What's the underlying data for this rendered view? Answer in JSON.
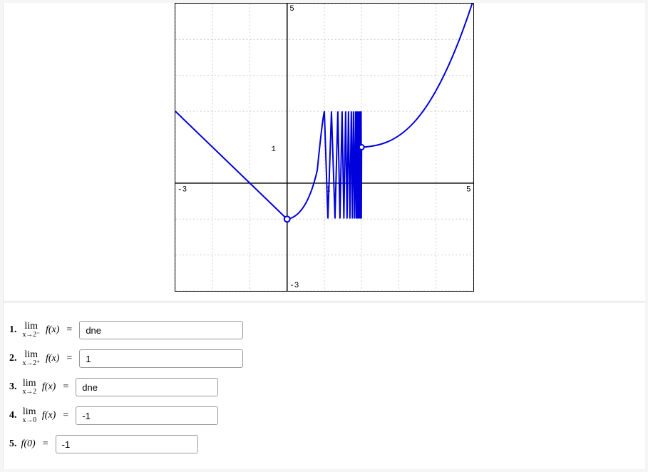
{
  "chart_data": {
    "type": "line",
    "title": "",
    "xlabel": "",
    "ylabel": "",
    "xlim": [
      -3,
      5
    ],
    "ylim": [
      -3,
      5
    ],
    "x_ticks": [
      -3,
      1.0,
      5
    ],
    "y_ticks": [
      -3,
      1.0,
      5
    ],
    "annotations": [
      "1.0",
      "1.0",
      "-3",
      "5",
      "-3",
      "5"
    ],
    "grid": true,
    "features": [
      {
        "desc": "linear decreasing segment",
        "from": [
          -3,
          2
        ],
        "to": [
          0,
          -1
        ]
      },
      {
        "desc": "open circle",
        "at": [
          0,
          -1
        ]
      },
      {
        "desc": "curve from (0,-1) up to local max",
        "to_approx": [
          1,
          2
        ]
      },
      {
        "desc": "dense oscillation (sin(1/(x-2)) style)",
        "interval_x": [
          1,
          2
        ],
        "amplitude_y": [
          -1,
          2
        ]
      },
      {
        "desc": "filled point at right side of oscillation",
        "at": [
          2,
          1
        ]
      },
      {
        "desc": "smooth increasing curve",
        "from": [
          2,
          1
        ],
        "to": [
          5,
          5
        ]
      }
    ]
  },
  "questions": [
    {
      "num": "1.",
      "lim_top": "lim",
      "lim_sub": "x→2⁻",
      "expr": "f(x)",
      "eq": "=",
      "value": "dne",
      "input_class": ""
    },
    {
      "num": "2.",
      "lim_top": "lim",
      "lim_sub": "x→2⁺",
      "expr": "f(x)",
      "eq": "=",
      "value": "1",
      "input_class": ""
    },
    {
      "num": "3.",
      "lim_top": "lim",
      "lim_sub": "x→2",
      "expr": "f(x)",
      "eq": "=",
      "value": "dne",
      "input_class": "short"
    },
    {
      "num": "4.",
      "lim_top": "lim",
      "lim_sub": "x→0",
      "expr": "f(x)",
      "eq": "=",
      "value": "-1",
      "input_class": "short"
    },
    {
      "num": "5.",
      "lim_top": "",
      "lim_sub": "",
      "expr": "f(0)",
      "eq": "=",
      "value": "-1",
      "input_class": "short"
    }
  ]
}
